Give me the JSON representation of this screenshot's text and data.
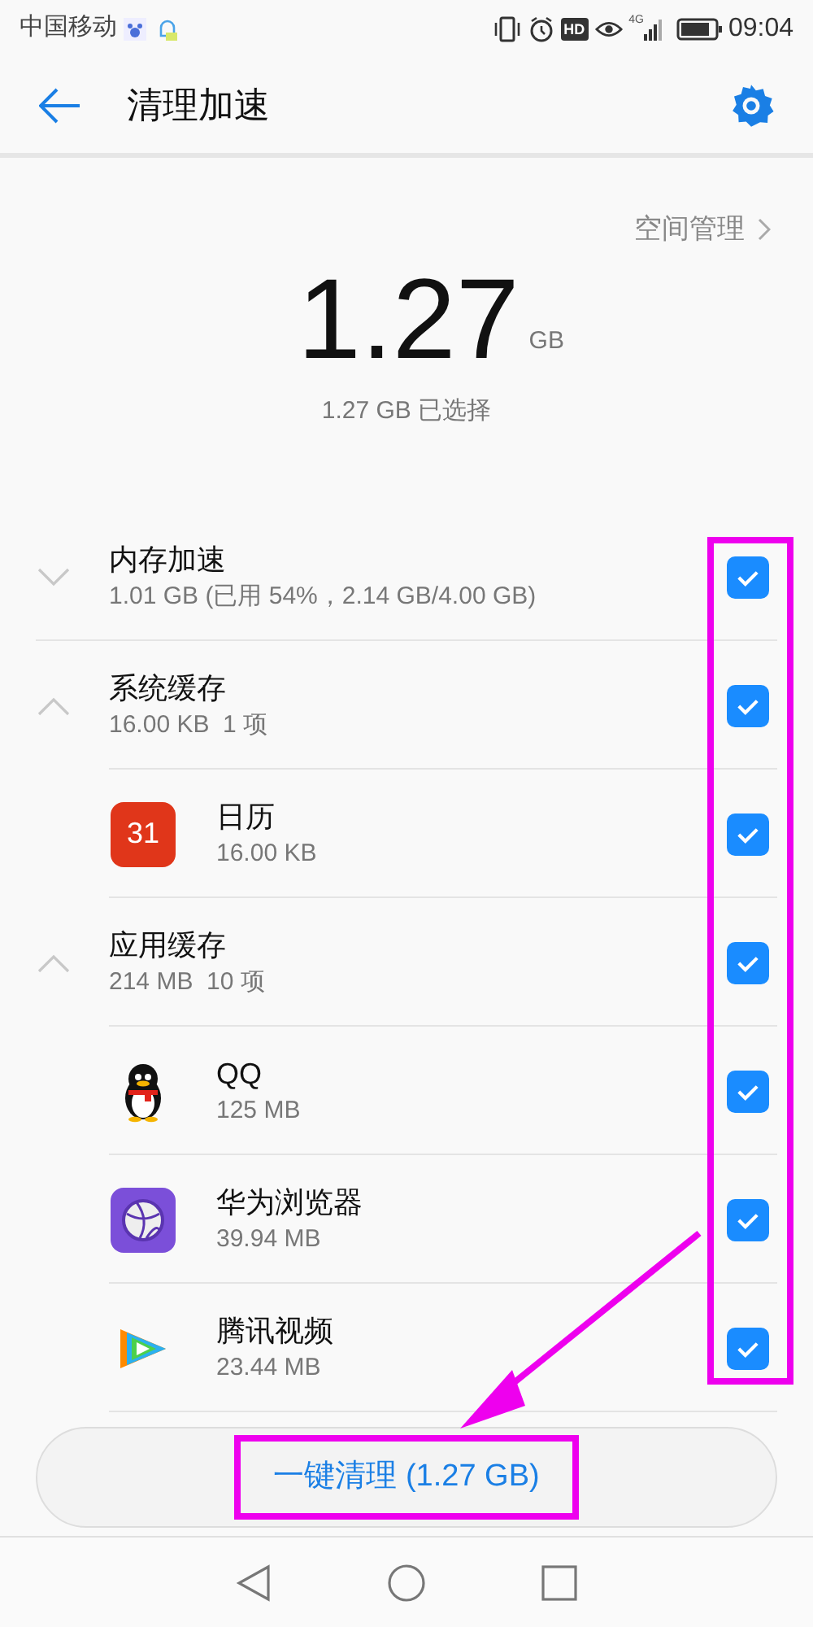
{
  "status_bar": {
    "carrier": "中国移动",
    "hd": "HD",
    "network": "4G",
    "time": "09:04"
  },
  "header": {
    "title": "清理加速"
  },
  "summary": {
    "link": "空间管理",
    "amount": "1.27",
    "unit": "GB",
    "selected_text": "1.27 GB 已选择"
  },
  "groups": [
    {
      "title": "内存加速",
      "detail": "1.01 GB (已用 54%，2.14 GB/4.00 GB)",
      "expanded": false,
      "checked": true
    },
    {
      "title": "系统缓存",
      "detail": "16.00 KB  1 项",
      "expanded": true,
      "checked": true,
      "children": [
        {
          "name": "日历",
          "size": "16.00 KB",
          "kind": "calendar",
          "icon_text": "31",
          "checked": true
        }
      ]
    },
    {
      "title": "应用缓存",
      "detail": "214 MB  10 项",
      "expanded": true,
      "checked": true,
      "children": [
        {
          "name": "QQ",
          "size": "125 MB",
          "kind": "penguin",
          "checked": true
        },
        {
          "name": "华为浏览器",
          "size": "39.94 MB",
          "kind": "browser",
          "checked": true
        },
        {
          "name": "腾讯视频",
          "size": "23.44 MB",
          "kind": "video",
          "checked": true
        }
      ]
    }
  ],
  "clean_button": {
    "label": "一键清理 (1.27 GB)"
  },
  "annotation": {
    "color": "#ee00ee"
  }
}
